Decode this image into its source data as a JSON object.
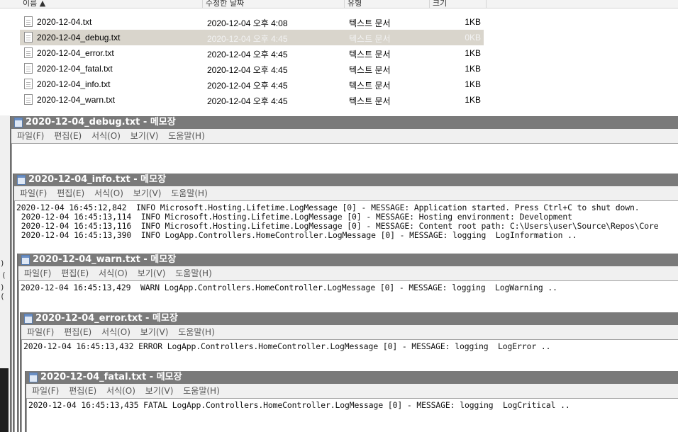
{
  "explorer": {
    "columns": [
      "이름",
      "수정한 날짜",
      "유형",
      "크기"
    ],
    "files": [
      {
        "name": "2020-12-04.txt",
        "modified": "2020-12-04 오후 4:08",
        "type": "텍스트 문서",
        "size": "1KB"
      },
      {
        "name": "2020-12-04_debug.txt",
        "modified": "2020-12-04 오후 4:45",
        "type": "텍스트 문서",
        "size": "0KB"
      },
      {
        "name": "2020-12-04_error.txt",
        "modified": "2020-12-04 오후 4:45",
        "type": "텍스트 문서",
        "size": "1KB"
      },
      {
        "name": "2020-12-04_fatal.txt",
        "modified": "2020-12-04 오후 4:45",
        "type": "텍스트 문서",
        "size": "1KB"
      },
      {
        "name": "2020-12-04_info.txt",
        "modified": "2020-12-04 오후 4:45",
        "type": "텍스트 문서",
        "size": "1KB"
      },
      {
        "name": "2020-12-04_warn.txt",
        "modified": "2020-12-04 오후 4:45",
        "type": "텍스트 문서",
        "size": "1KB"
      }
    ]
  },
  "menu": [
    "파일(F)",
    "편집(E)",
    "서식(O)",
    "보기(V)",
    "도움말(H)"
  ],
  "windows": [
    {
      "title": "2020-12-04_debug.txt - 메모장",
      "lines": []
    },
    {
      "title": "2020-12-04_info.txt - 메모장",
      "lines": [
        "2020-12-04 16:45:12,842  INFO Microsoft.Hosting.Lifetime.LogMessage [0] - MESSAGE: Application started. Press Ctrl+C to shut down.",
        " 2020-12-04 16:45:13,114  INFO Microsoft.Hosting.Lifetime.LogMessage [0] - MESSAGE: Hosting environment: Development",
        " 2020-12-04 16:45:13,116  INFO Microsoft.Hosting.Lifetime.LogMessage [0] - MESSAGE: Content root path: C:\\Users\\user\\Source\\Repos\\Core",
        " 2020-12-04 16:45:13,390  INFO LogApp.Controllers.HomeController.LogMessage [0] - MESSAGE: logging  LogInformation .."
      ]
    },
    {
      "title": "2020-12-04_warn.txt - 메모장",
      "lines": [
        "2020-12-04 16:45:13,429  WARN LogApp.Controllers.HomeController.LogMessage [0] - MESSAGE: logging  LogWarning .."
      ]
    },
    {
      "title": "2020-12-04_error.txt - 메모장",
      "lines": [
        "2020-12-04 16:45:13,432 ERROR LogApp.Controllers.HomeController.LogMessage [0] - MESSAGE: logging  LogError .."
      ]
    },
    {
      "title": "2020-12-04_fatal.txt - 메모장",
      "lines": [
        "2020-12-04 16:45:13,435 FATAL LogApp.Controllers.HomeController.LogMessage [0] - MESSAGE: logging  LogCritical .."
      ]
    }
  ]
}
